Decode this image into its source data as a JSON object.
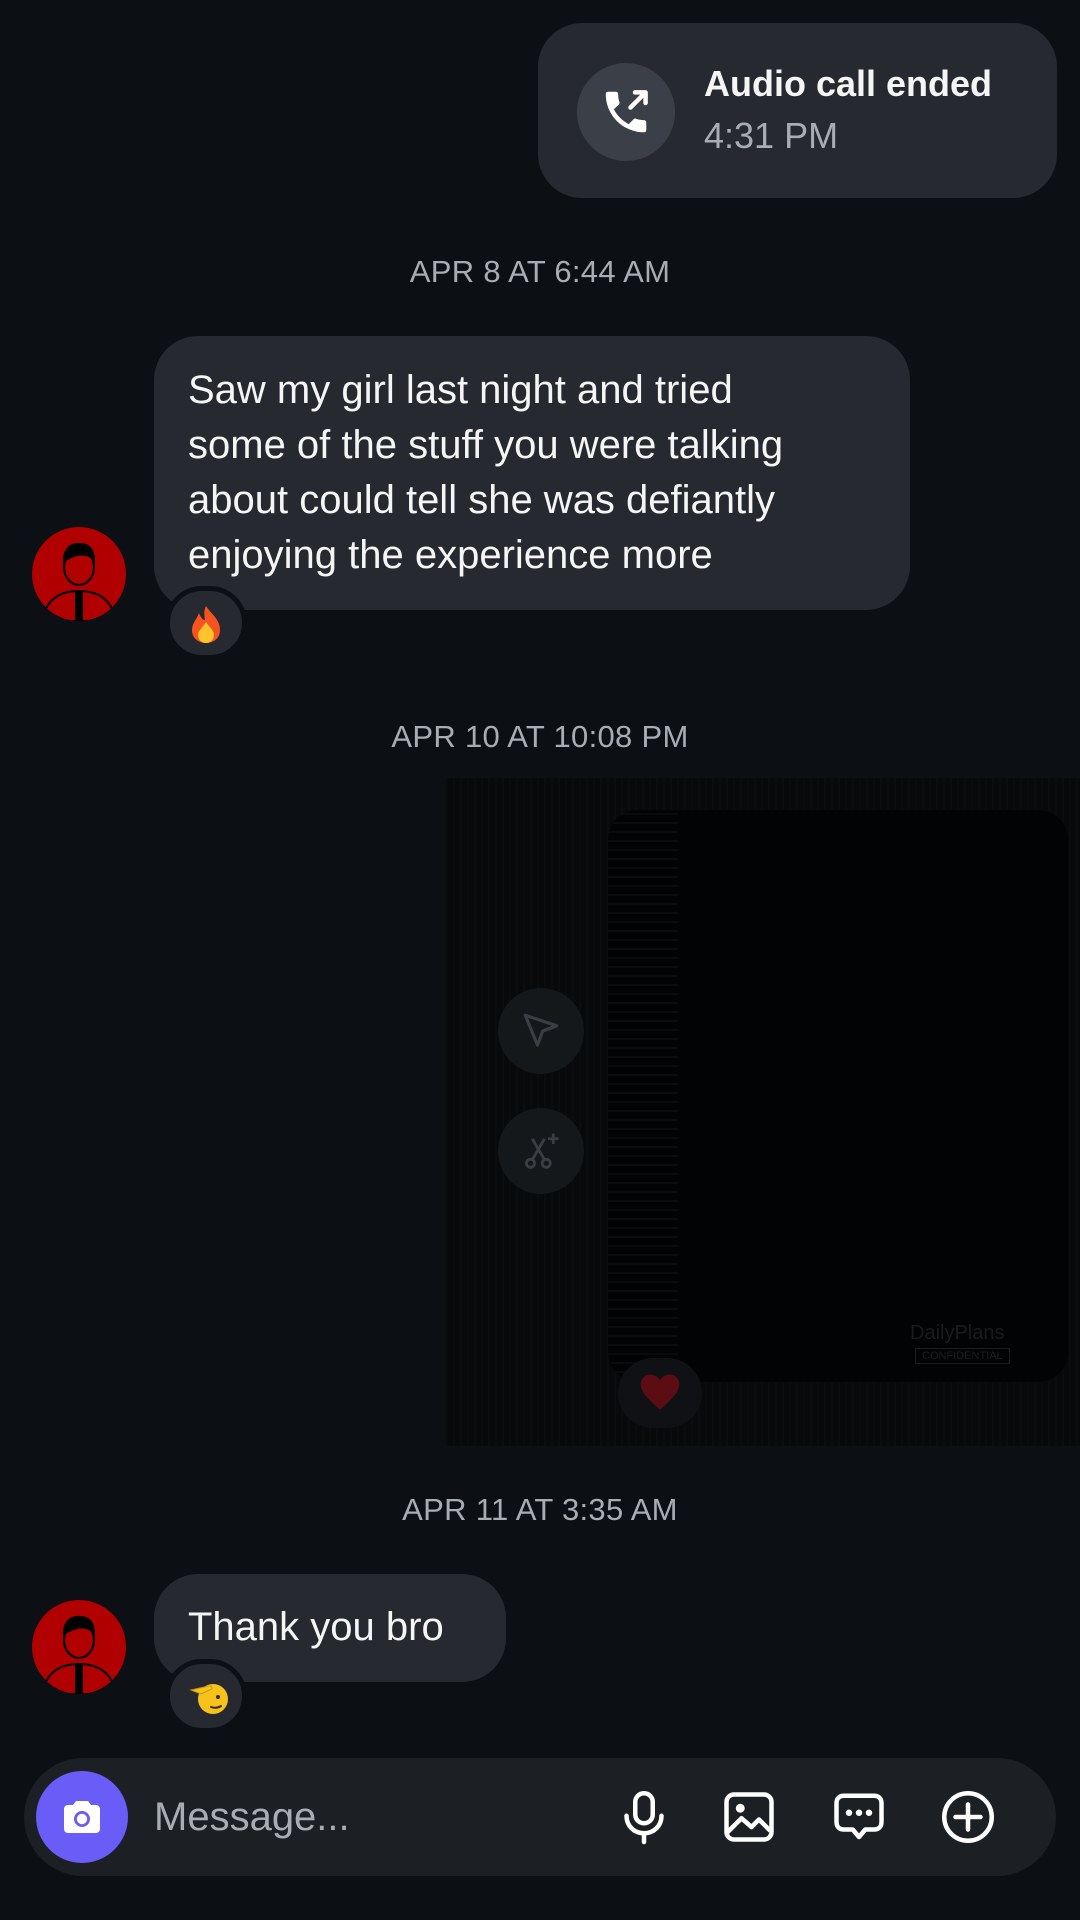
{
  "call": {
    "title": "Audio call ended",
    "time": "4:31 PM",
    "icon": "outgoing-call-icon"
  },
  "timestamps": {
    "first": "APR 8 AT 6:44 AM",
    "second": "APR 10 AT 10:08 PM",
    "third": "APR 11 AT 3:35 AM"
  },
  "messages": [
    {
      "sender": "contact",
      "text": "Saw my girl last night and tried some of the stuff you were talking about could tell she was defiantly enjoying the experience more",
      "lines": [
        "Saw my girl last night and tried",
        "some of the stuff you were talking",
        "about could tell she was defiantly",
        "enjoying the experience more"
      ],
      "reaction": "fire-emoji"
    },
    {
      "sender": "self",
      "type": "shared-post",
      "watermark": "DailyPlans",
      "stamp": "CONFIDENTIAL",
      "actions": [
        "send-icon",
        "remix-icon"
      ],
      "reaction": "red-heart-emoji"
    },
    {
      "sender": "contact",
      "text": "Thank you bro",
      "reaction": "saluting-face-emoji"
    }
  ],
  "composer": {
    "placeholder": "Message...",
    "icons": [
      "camera-icon",
      "microphone-icon",
      "gallery-icon",
      "sticker-icon",
      "plus-icon"
    ]
  },
  "colors": {
    "background": "#0c1014",
    "bubble": "#262a30",
    "accent": "#6a5cf6",
    "avatar": "#b00000",
    "muted_text": "#a8adb4"
  }
}
